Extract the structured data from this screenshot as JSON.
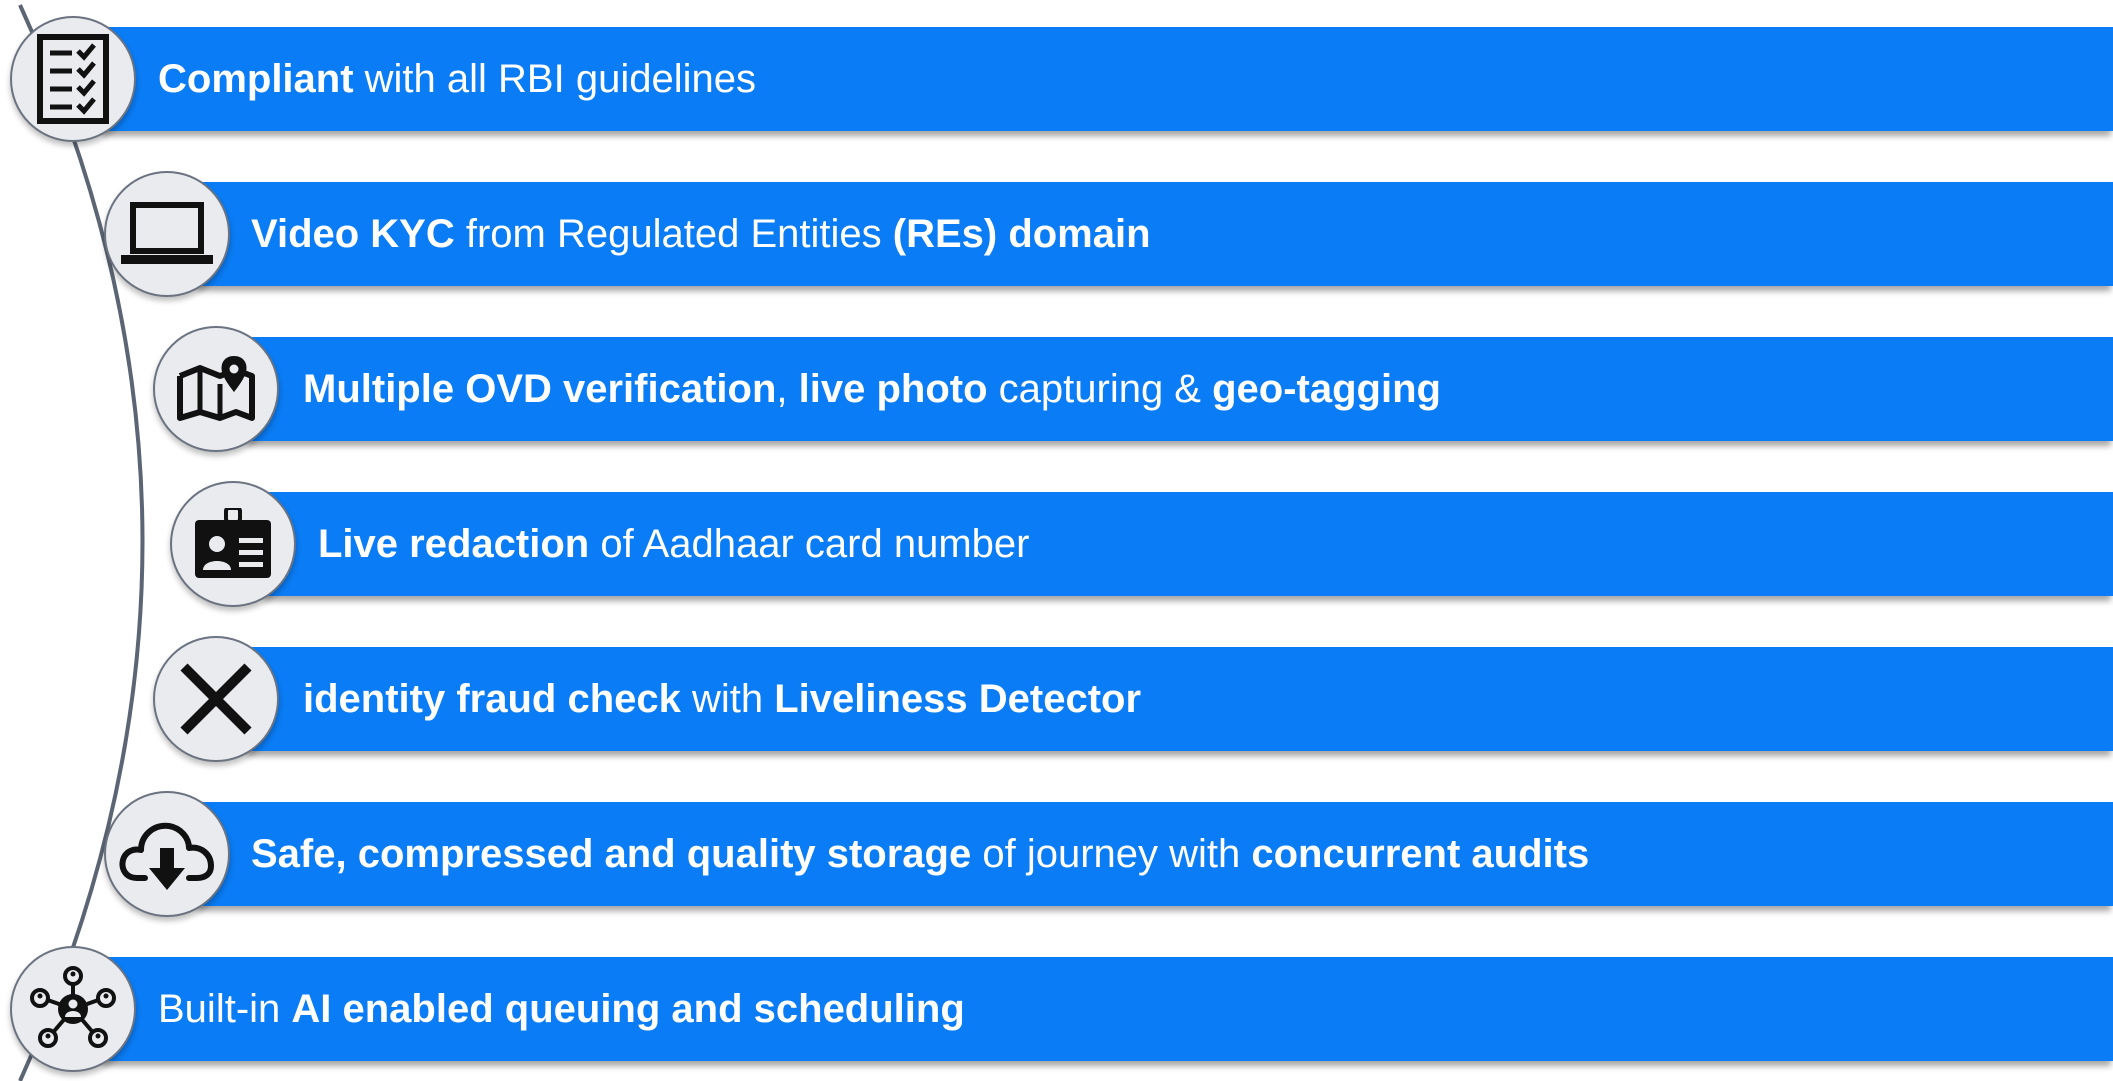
{
  "accent_color": "#0a7cf5",
  "features": [
    {
      "icon": "checklist-icon",
      "segments": [
        {
          "text": "Compliant",
          "bold": true
        },
        {
          "text": " with all RBI guidelines",
          "bold": false
        }
      ]
    },
    {
      "icon": "laptop-icon",
      "segments": [
        {
          "text": "Video KYC",
          "bold": true
        },
        {
          "text": " from Regulated Entities ",
          "bold": false
        },
        {
          "text": "(REs) domain",
          "bold": true
        }
      ]
    },
    {
      "icon": "map-pin-icon",
      "segments": [
        {
          "text": "Multiple OVD verification",
          "bold": true
        },
        {
          "text": ", ",
          "bold": false
        },
        {
          "text": "live photo",
          "bold": true
        },
        {
          "text": " capturing & ",
          "bold": false
        },
        {
          "text": "geo-tagging",
          "bold": true
        }
      ]
    },
    {
      "icon": "id-card-icon",
      "segments": [
        {
          "text": "Live redaction",
          "bold": true
        },
        {
          "text": " of Aadhaar card number",
          "bold": false
        }
      ]
    },
    {
      "icon": "close-x-icon",
      "segments": [
        {
          "text": "identity fraud check",
          "bold": true
        },
        {
          "text": " with ",
          "bold": false
        },
        {
          "text": "Liveliness Detector",
          "bold": true
        }
      ]
    },
    {
      "icon": "cloud-download-icon",
      "segments": [
        {
          "text": "Safe, compressed and quality storage",
          "bold": true
        },
        {
          "text": " of journey with ",
          "bold": false
        },
        {
          "text": "concurrent audits",
          "bold": true
        }
      ]
    },
    {
      "icon": "network-users-icon",
      "segments": [
        {
          "text": "Built-in ",
          "bold": false
        },
        {
          "text": "AI enabled queuing and scheduling",
          "bold": true
        }
      ]
    }
  ]
}
